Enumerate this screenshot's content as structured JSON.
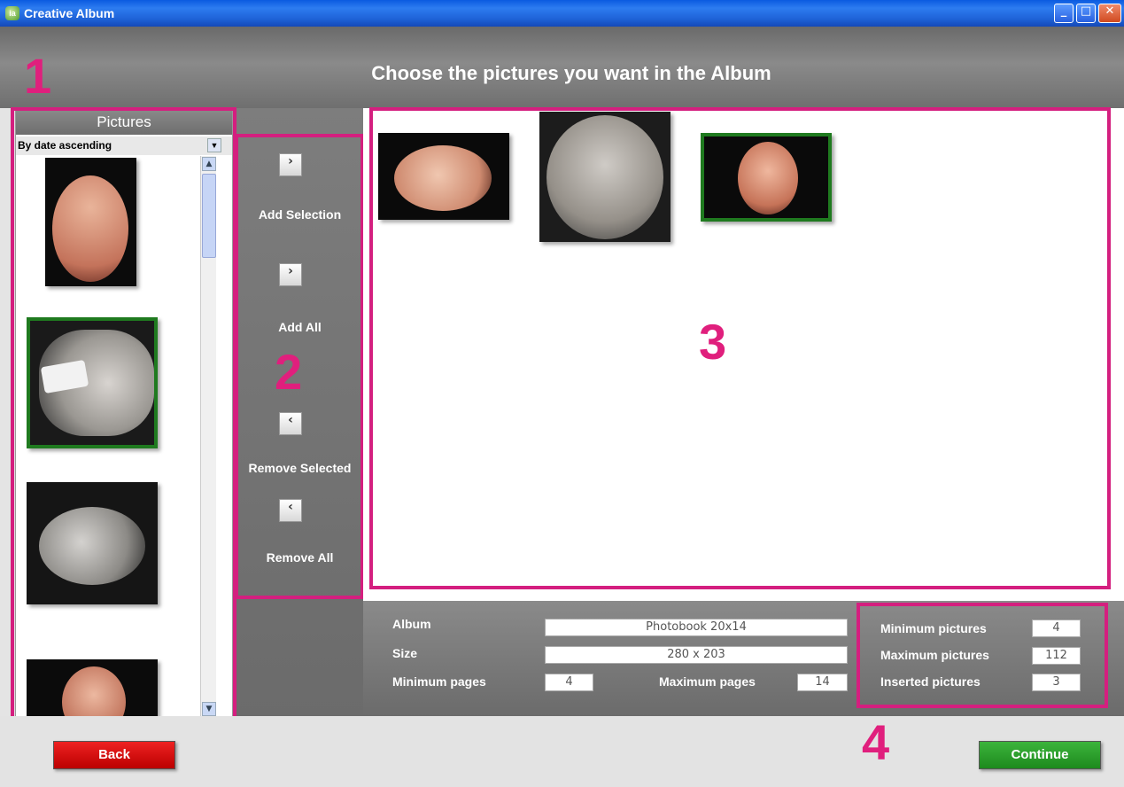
{
  "window": {
    "title": "Creative Album",
    "icon": "app-logo-icon"
  },
  "header": {
    "title": "Choose the pictures you want in the Album"
  },
  "markers": [
    "1",
    "2",
    "3",
    "4"
  ],
  "pictures_panel": {
    "title": "Pictures",
    "sort_value": "By date ascending"
  },
  "actions": {
    "add_selection": "Add Selection",
    "add_all": "Add All",
    "remove_selected": "Remove Selected",
    "remove_all": "Remove All",
    "add_glyph": "›",
    "remove_glyph": "‹"
  },
  "album": {
    "album_label": "Album",
    "album_value": "Photobook 20x14",
    "size_label": "Size",
    "size_value": "280 x 203",
    "min_pages_label": "Minimum pages",
    "min_pages_value": "4",
    "max_pages_label": "Maximum pages",
    "max_pages_value": "14"
  },
  "stats": {
    "min_pictures_label": "Minimum pictures",
    "min_pictures_value": "4",
    "max_pictures_label": "Maximum pictures",
    "max_pictures_value": "112",
    "inserted_pictures_label": "Inserted pictures",
    "inserted_pictures_value": "3"
  },
  "footer": {
    "back": "Back",
    "continue": "Continue"
  },
  "colors": {
    "accent_marker": "#d41f7f",
    "selected_border": "#1f7a1f",
    "back_button": "#cc1111",
    "continue_button": "#2a9a2a"
  }
}
